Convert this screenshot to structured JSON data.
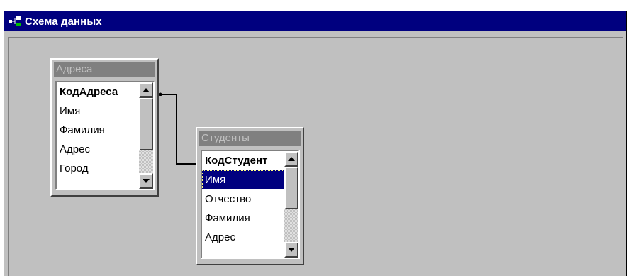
{
  "window": {
    "title": "Схема данных",
    "icon": "relationships-icon"
  },
  "tables": {
    "addresses": {
      "title": "Адреса",
      "fields": [
        "КодАдреса",
        "Имя",
        "Фамилия",
        "Адрес",
        "Город"
      ],
      "key_field": "КодАдреса"
    },
    "students": {
      "title": "Студенты",
      "fields": [
        "КодСтудент",
        "Имя",
        "Отчество",
        "Фамилия",
        "Адрес"
      ],
      "key_field": "КодСтудент",
      "selected_field": "Имя"
    }
  },
  "colors": {
    "titlebar": "#00007f",
    "window_bg": "#c0c0c0",
    "inactive_caption": "#808080",
    "selection": "#00007f"
  }
}
